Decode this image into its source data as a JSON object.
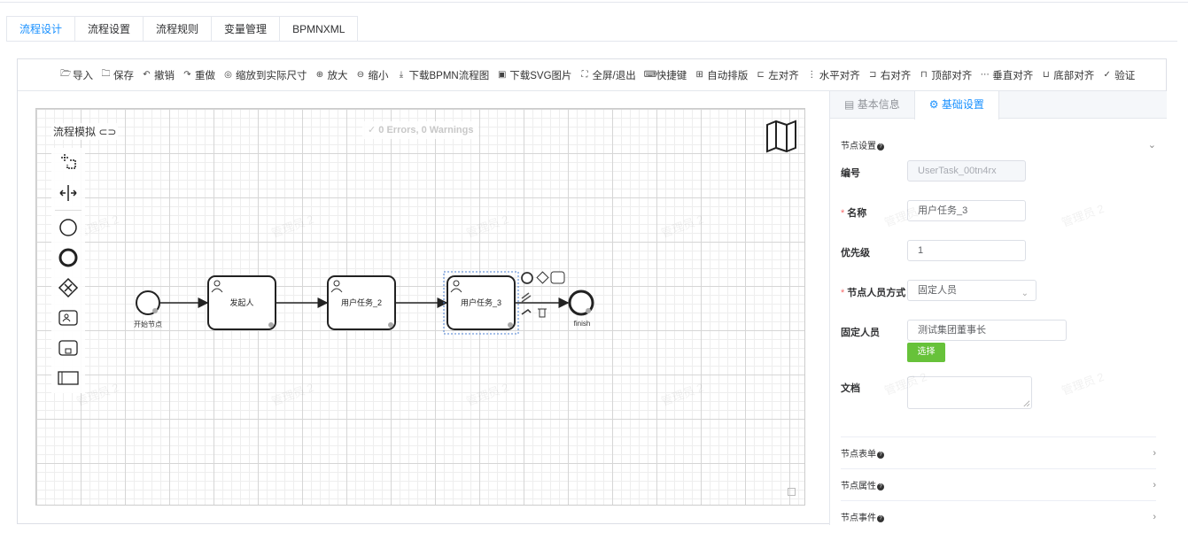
{
  "tabs": [
    {
      "label": "流程设计",
      "active": true
    },
    {
      "label": "流程设置",
      "active": false
    },
    {
      "label": "流程规则",
      "active": false
    },
    {
      "label": "变量管理",
      "active": false
    },
    {
      "label": "BPMNXML",
      "active": false
    }
  ],
  "toolbar": [
    {
      "icon": "folder-open-icon",
      "glyph": "🗁",
      "label": "导入"
    },
    {
      "icon": "folder-icon",
      "glyph": "🗀",
      "label": "保存"
    },
    {
      "icon": "undo-icon",
      "glyph": "↶",
      "label": "撤销"
    },
    {
      "icon": "redo-icon",
      "glyph": "↷",
      "label": "重做"
    },
    {
      "icon": "fit-icon",
      "glyph": "◎",
      "label": "缩放到实际尺寸"
    },
    {
      "icon": "zoom-in-icon",
      "glyph": "⊕",
      "label": "放大"
    },
    {
      "icon": "zoom-out-icon",
      "glyph": "⊖",
      "label": "缩小"
    },
    {
      "icon": "download-icon",
      "glyph": "⤓",
      "label": "下载BPMN流程图"
    },
    {
      "icon": "image-icon",
      "glyph": "▣",
      "label": "下载SVG图片"
    },
    {
      "icon": "fullscreen-icon",
      "glyph": "⛶",
      "label": "全屏/退出"
    },
    {
      "icon": "keyboard-icon",
      "glyph": "⌨",
      "label": "快捷键"
    },
    {
      "icon": "auto-layout-icon",
      "glyph": "⊞",
      "label": "自动排版"
    },
    {
      "icon": "align-left-icon",
      "glyph": "⊏",
      "label": "左对齐"
    },
    {
      "icon": "align-center-icon",
      "glyph": "⋮",
      "label": "水平对齐"
    },
    {
      "icon": "align-right-icon",
      "glyph": "⊐",
      "label": "右对齐"
    },
    {
      "icon": "align-top-icon",
      "glyph": "⊓",
      "label": "顶部对齐"
    },
    {
      "icon": "align-middle-icon",
      "glyph": "⋯",
      "label": "垂直对齐"
    },
    {
      "icon": "align-bottom-icon",
      "glyph": "⊔",
      "label": "底部对齐"
    },
    {
      "icon": "check-icon",
      "glyph": "✓",
      "label": "验证"
    }
  ],
  "canvas": {
    "simulation_label": "流程模拟",
    "validation": "0 Errors, 0 Warnings",
    "nodes": {
      "start": "开始节点",
      "task1": "发起人",
      "task2": "用户任务_2",
      "task3": "用户任务_3",
      "end": "finish"
    },
    "watermark": "管理员 2"
  },
  "panel": {
    "tabs": [
      {
        "label": "基本信息",
        "icon": "calendar-icon",
        "active": false
      },
      {
        "label": "基础设置",
        "icon": "gear-icon",
        "active": true
      }
    ],
    "node_settings": "节点设置",
    "fields": {
      "id_label": "编号",
      "id_value": "UserTask_00tn4rx",
      "name_label": "名称",
      "name_value": "用户任务_3",
      "priority_label": "优先级",
      "priority_value": "1",
      "assignee_type_label": "节点人员方式",
      "assignee_type_value": "固定人员",
      "fixed_user_label": "固定人员",
      "fixed_user_value": "测试集团董事长",
      "select_button": "选择",
      "doc_label": "文档"
    },
    "sections": [
      "节点表单",
      "节点属性",
      "节点事件"
    ]
  }
}
